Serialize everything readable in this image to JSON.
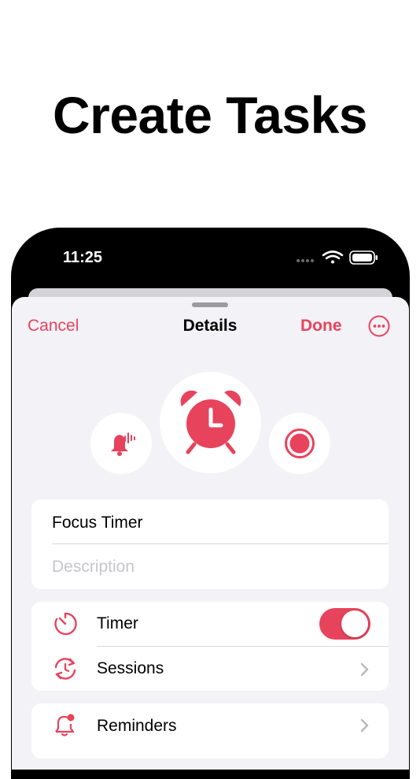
{
  "headline": "Create Tasks",
  "status_bar": {
    "time": "11:25",
    "icons": [
      "signal-dots-icon",
      "wifi-icon",
      "battery-icon"
    ]
  },
  "nav": {
    "cancel": "Cancel",
    "title": "Details",
    "done": "Done",
    "more_icon": "ellipsis-circle-icon"
  },
  "sound_options": [
    {
      "name": "bell-sound-icon",
      "selected": false
    },
    {
      "name": "alarm-clock-icon",
      "selected": true
    },
    {
      "name": "record-icon",
      "selected": false
    }
  ],
  "task": {
    "name": "Focus Timer",
    "description_placeholder": "Description"
  },
  "settings": {
    "timer": {
      "label": "Timer",
      "enabled": true
    },
    "sessions": {
      "label": "Sessions"
    },
    "reminders": {
      "label": "Reminders"
    }
  },
  "colors": {
    "accent": "#e8435c",
    "sheet_background": "#f2f2f7"
  }
}
